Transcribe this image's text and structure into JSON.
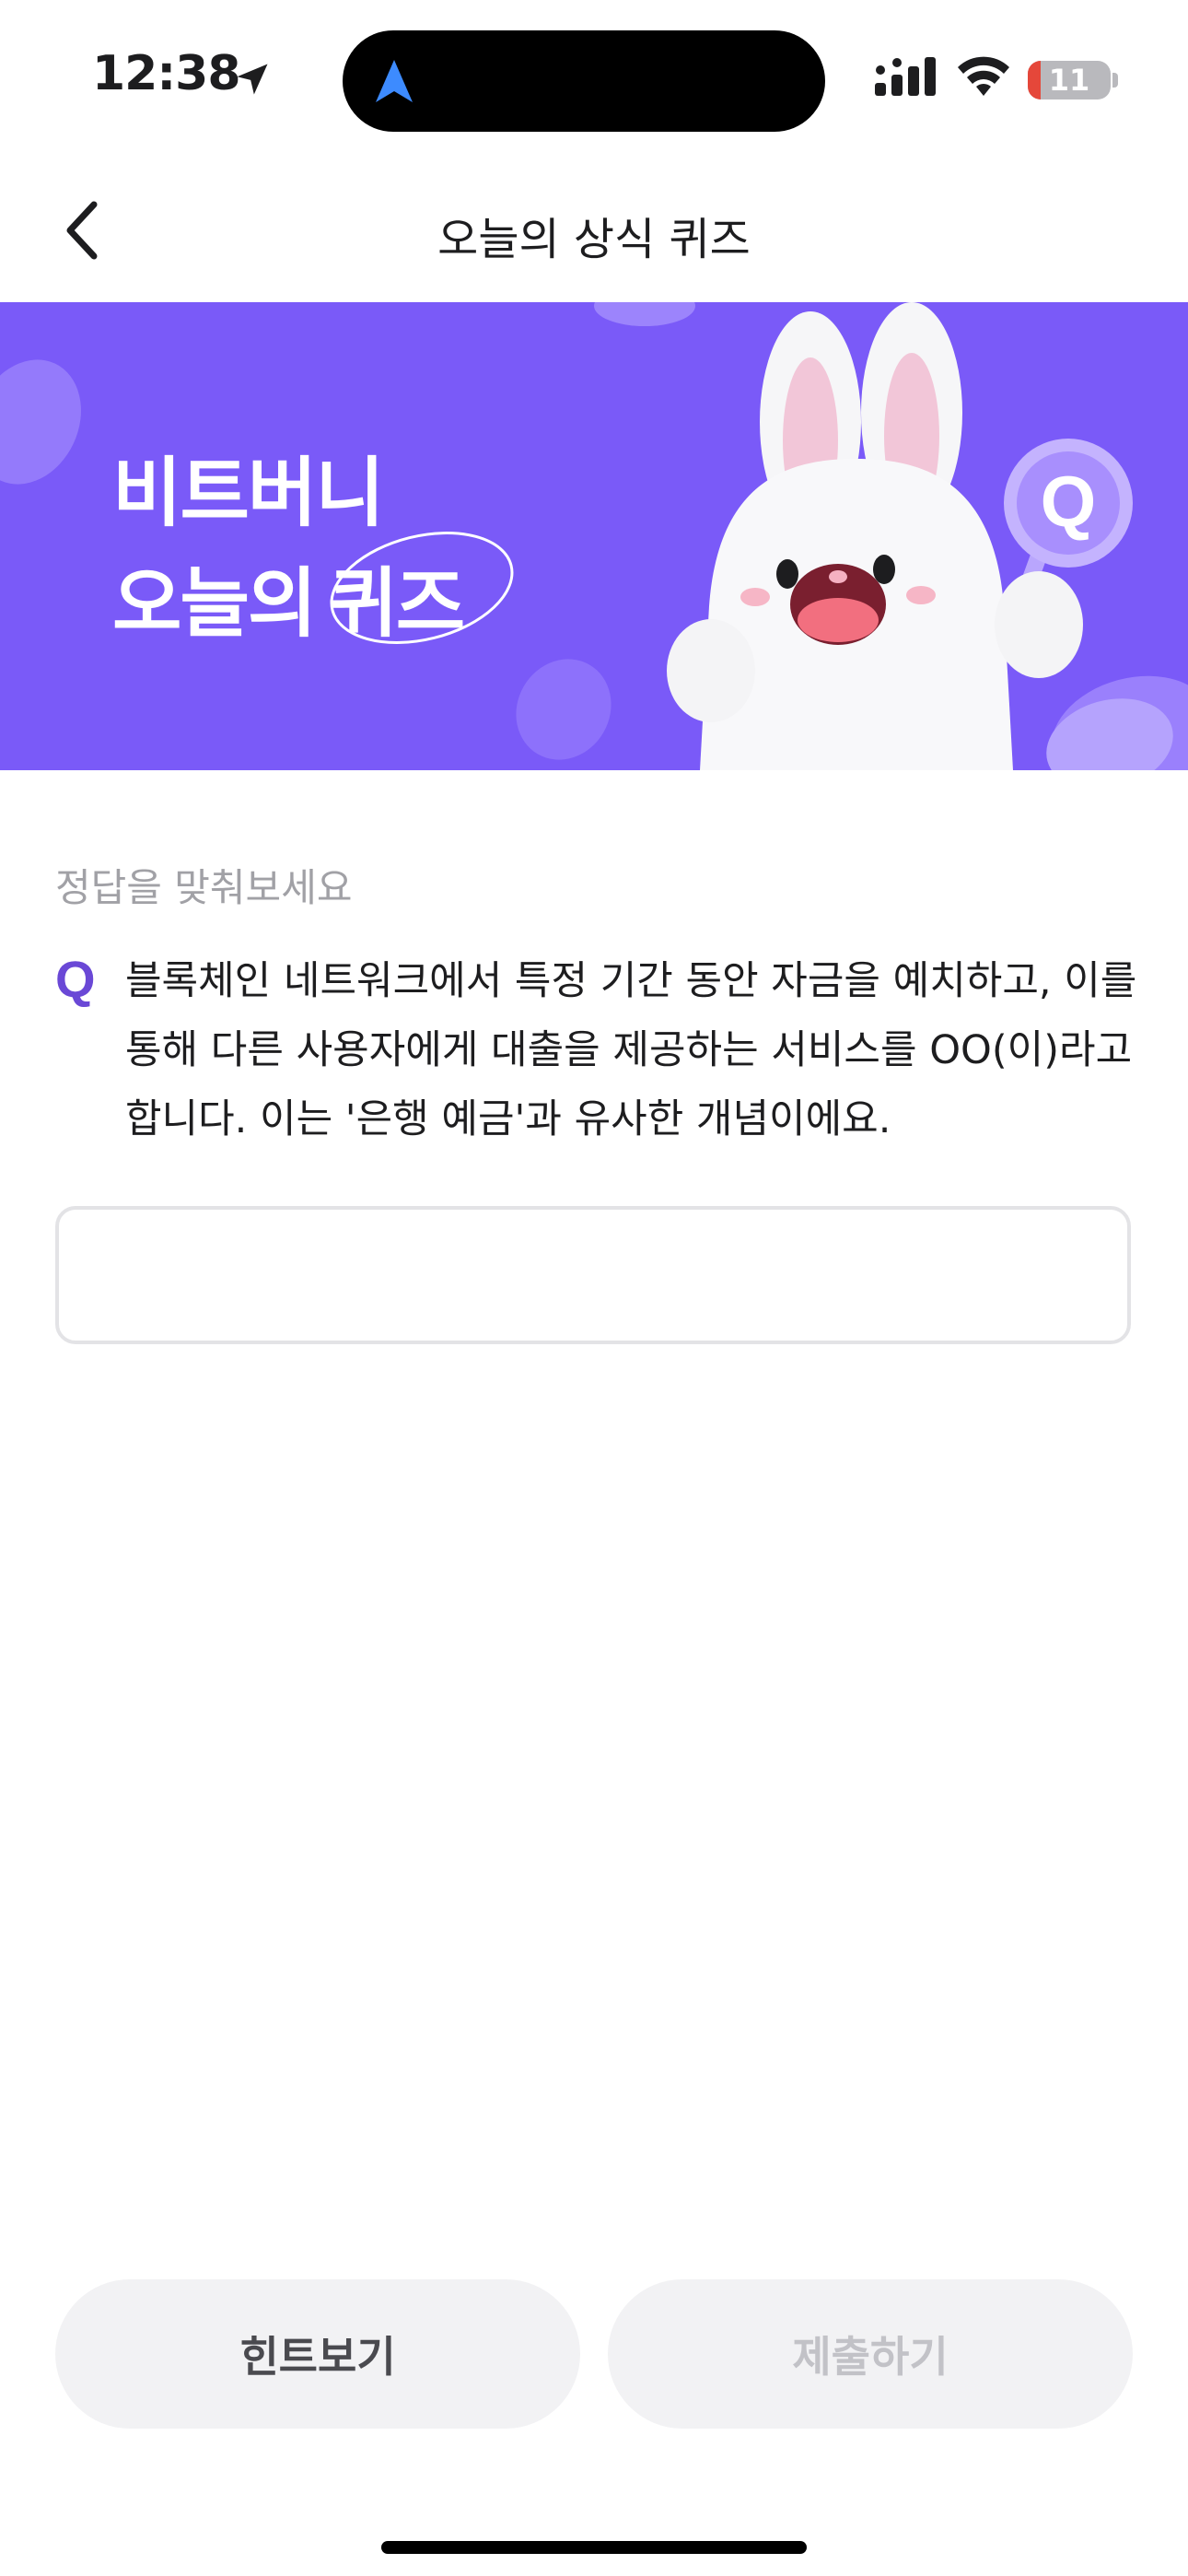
{
  "status_bar": {
    "time": "12:38",
    "battery": "11",
    "icons": [
      "location-arrow-icon",
      "navigation-icon",
      "signal-icon",
      "wifi-icon",
      "battery-icon"
    ]
  },
  "header": {
    "title": "오늘의 상식 퀴즈",
    "back_icon": "chevron-left-icon"
  },
  "banner": {
    "line1": "비트버니",
    "line2_prefix": "오늘의",
    "line2_emph": "퀴즈",
    "badge_letter": "Q",
    "background": "#7a5af8"
  },
  "quiz": {
    "prompt": "정답을 맞춰보세요",
    "q_label": "Q",
    "question": "블록체인 네트워크에서 특정 기간 동안 자금을 예치하고, 이를 통해 다른 사용자에게 대출을 제공하는 서비스를 OO(이)라고 합니다. 이는 '은행 예금'과 유사한 개념이에요.",
    "answer_value": "",
    "accent": "#6a48d6"
  },
  "buttons": {
    "hint_label": "힌트보기",
    "submit_label": "제출하기"
  }
}
